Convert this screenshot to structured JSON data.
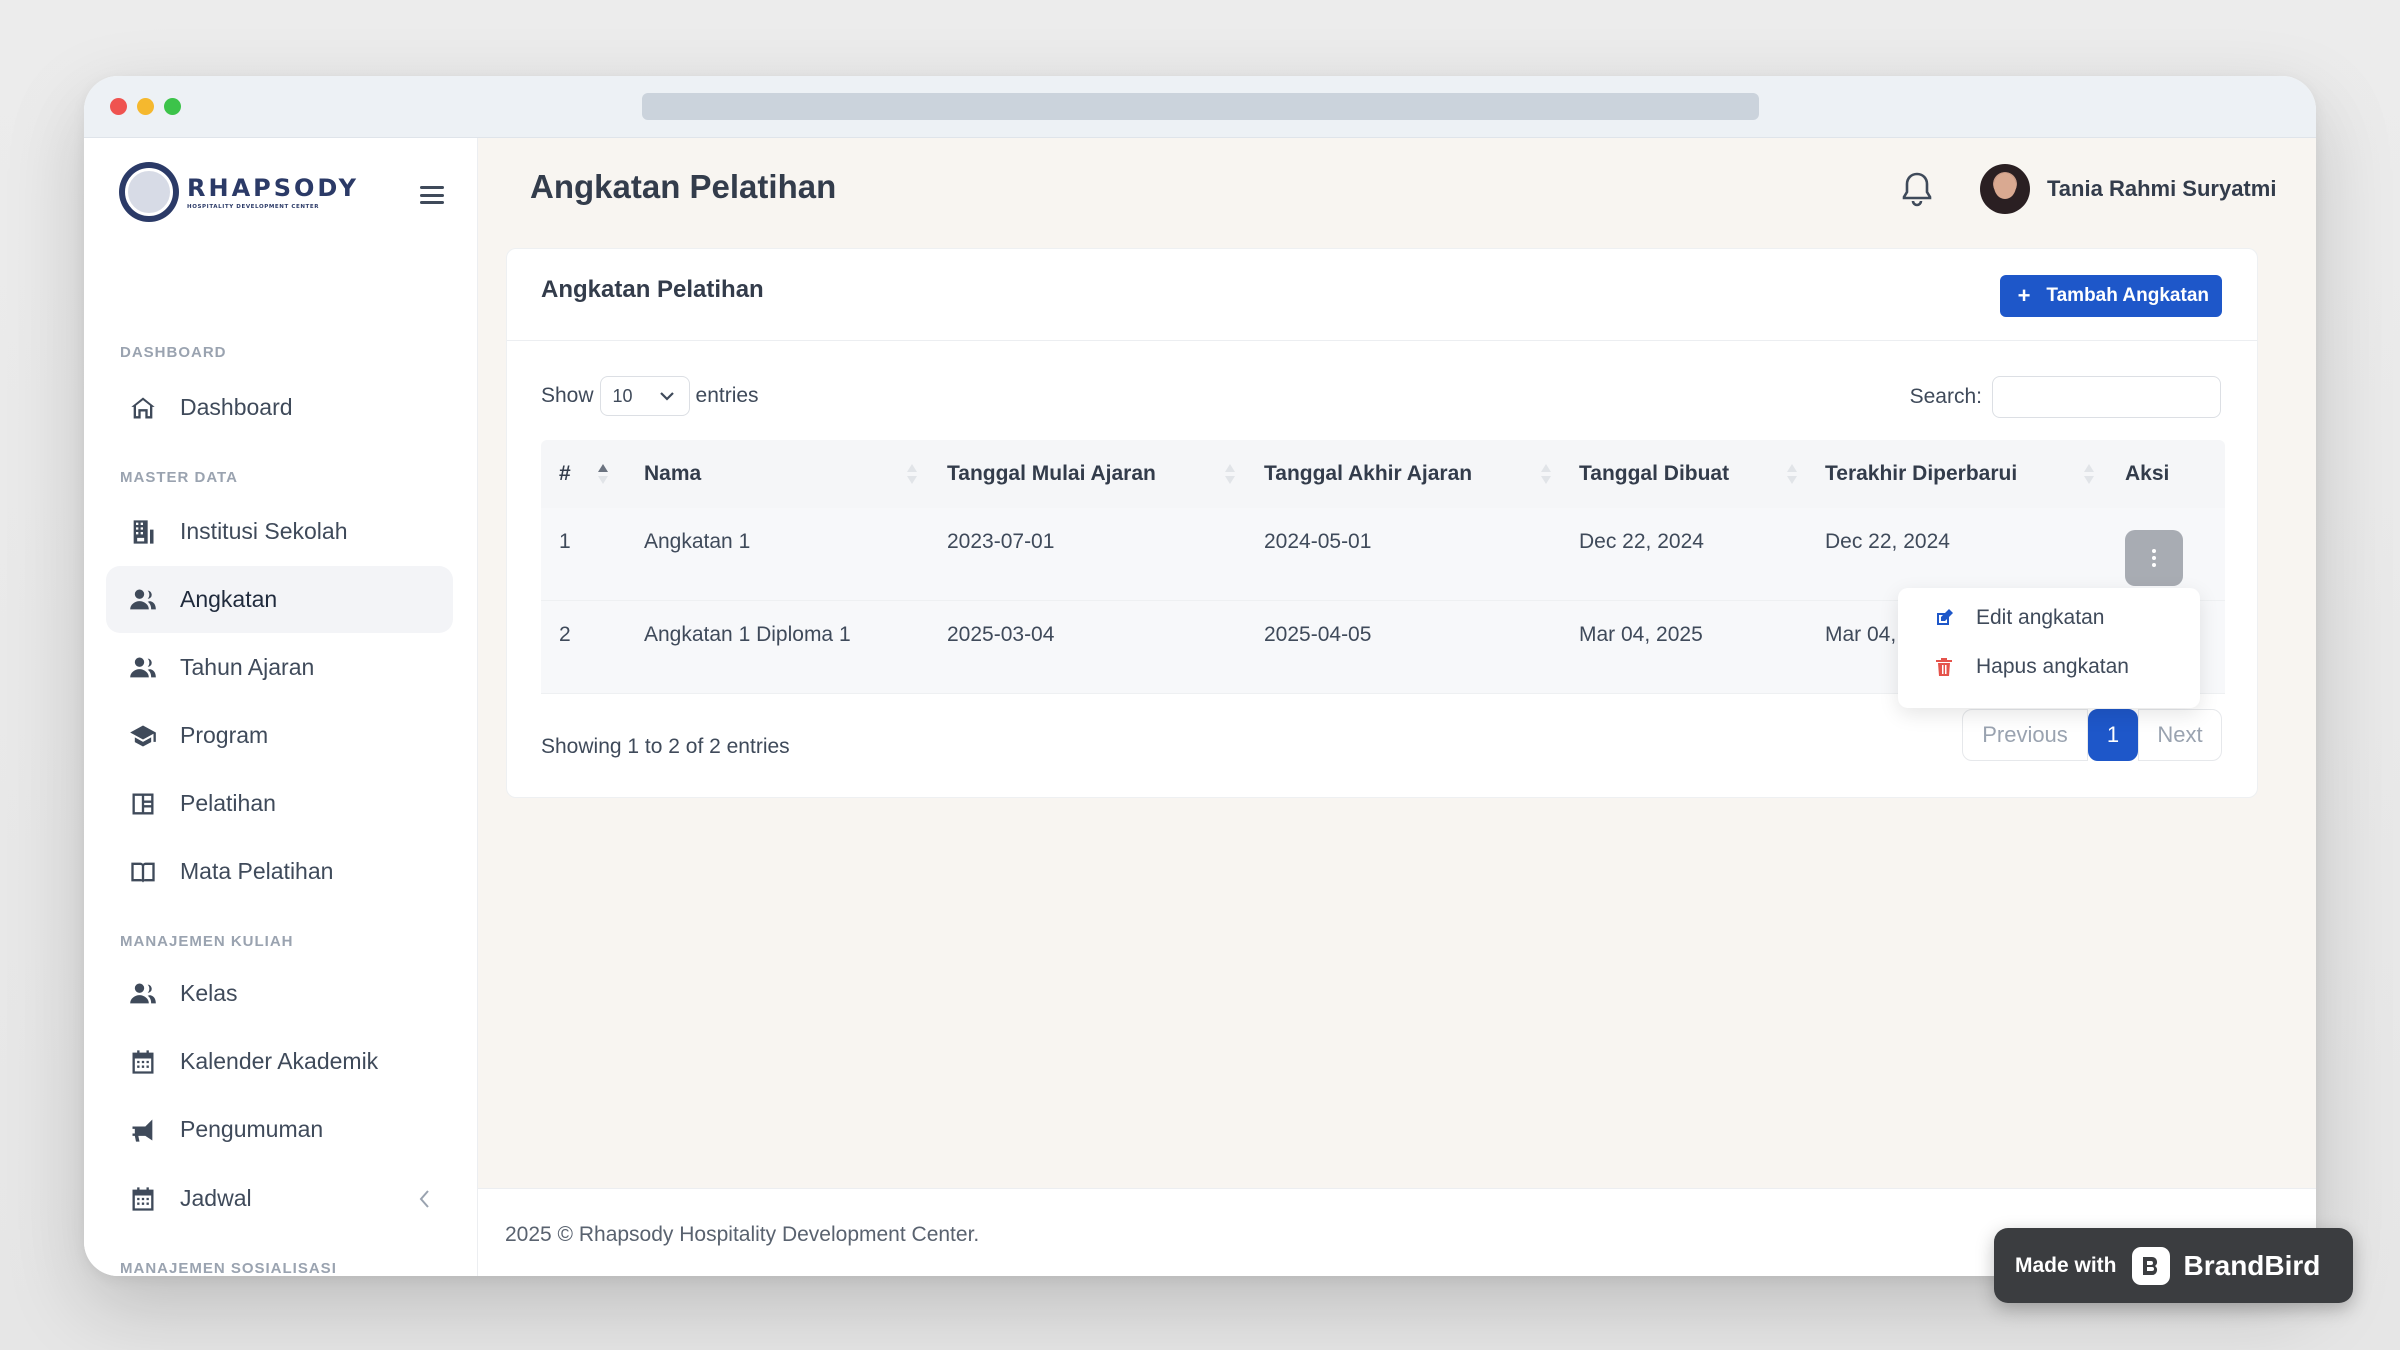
{
  "app": {
    "logo_title": "RHAPSODY",
    "logo_subtitle": "HOSPITALITY DEVELOPMENT CENTER"
  },
  "sidebar": {
    "sections": [
      {
        "label": "DASHBOARD"
      },
      {
        "label": "MASTER DATA"
      },
      {
        "label": "MANAJEMEN KULIAH"
      },
      {
        "label": "MANAJEMEN SOSIALISASI"
      }
    ],
    "items": [
      {
        "label": "Dashboard",
        "icon": "home-icon"
      },
      {
        "label": "Institusi Sekolah",
        "icon": "building-icon"
      },
      {
        "label": "Angkatan",
        "icon": "users-icon",
        "active": true
      },
      {
        "label": "Tahun Ajaran",
        "icon": "users-icon"
      },
      {
        "label": "Program",
        "icon": "graduation-cap-icon"
      },
      {
        "label": "Pelatihan",
        "icon": "layout-icon"
      },
      {
        "label": "Mata Pelatihan",
        "icon": "book-icon"
      },
      {
        "label": "Kelas",
        "icon": "users-icon"
      },
      {
        "label": "Kalender Akademik",
        "icon": "calendar-icon"
      },
      {
        "label": "Pengumuman",
        "icon": "megaphone-icon"
      },
      {
        "label": "Jadwal",
        "icon": "calendar-icon"
      }
    ]
  },
  "header": {
    "page_title": "Angkatan Pelatihan",
    "user_name": "Tania Rahmi Suryatmi"
  },
  "card": {
    "title": "Angkatan Pelatihan",
    "add_button": "Tambah Angkatan",
    "show_label": "Show",
    "entries_label": "entries",
    "page_size": "10",
    "search_label": "Search:",
    "search_value": ""
  },
  "table": {
    "columns": [
      "#",
      "Nama",
      "Tanggal Mulai Ajaran",
      "Tanggal Akhir Ajaran",
      "Tanggal Dibuat",
      "Terakhir Diperbarui",
      "Aksi"
    ],
    "rows": [
      [
        "1",
        "Angkatan 1",
        "2023-07-01",
        "2024-05-01",
        "Dec 22, 2024",
        "Dec 22, 2024"
      ],
      [
        "2",
        "Angkatan 1 Diploma 1",
        "2025-03-04",
        "2025-04-05",
        "Mar 04, 2025",
        "Mar 04, 2025"
      ]
    ]
  },
  "dropdown": {
    "edit_label": "Edit angkatan",
    "delete_label": "Hapus angkatan"
  },
  "pagination": {
    "info": "Showing 1 to 2 of 2 entries",
    "previous": "Previous",
    "current": "1",
    "next": "Next"
  },
  "footer": {
    "text": "2025 © Rhapsody Hospitality Development Center."
  },
  "badge": {
    "made_with": "Made with",
    "brand": "BrandBird"
  },
  "colors": {
    "primary": "#1e57c9",
    "danger": "#e5534b",
    "main_bg": "#f8f5f1"
  }
}
